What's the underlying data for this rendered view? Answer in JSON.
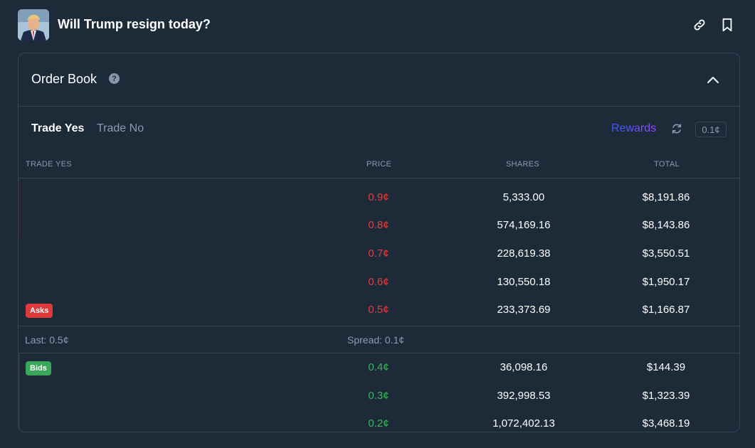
{
  "header": {
    "title": "Will Trump resign today?",
    "link_icon": "link-icon",
    "bookmark_icon": "bookmark-icon"
  },
  "order_book": {
    "title": "Order Book",
    "help_icon": "question-circle-icon",
    "help_glyph": "?",
    "collapse_icon": "chevron-up-icon"
  },
  "tabs": [
    {
      "label": "Trade Yes",
      "active": true
    },
    {
      "label": "Trade No",
      "active": false
    }
  ],
  "toolbar": {
    "rewards_label": "Rewards",
    "refresh_icon": "refresh-icon",
    "tick_size": "0.1¢"
  },
  "columns": {
    "side": "TRADE YES",
    "price": "PRICE",
    "shares": "SHARES",
    "total": "TOTAL"
  },
  "asks": [
    {
      "price": "0.9¢",
      "shares": "5,333.00",
      "total": "$8,191.86"
    },
    {
      "price": "0.8¢",
      "shares": "574,169.16",
      "total": "$8,143.86"
    },
    {
      "price": "0.7¢",
      "shares": "228,619.38",
      "total": "$3,550.51"
    },
    {
      "price": "0.6¢",
      "shares": "130,550.18",
      "total": "$1,950.17"
    },
    {
      "price": "0.5¢",
      "shares": "233,373.69",
      "total": "$1,166.87"
    }
  ],
  "asks_badge": "Asks",
  "spread_row": {
    "last": "Last: 0.5¢",
    "spread": "Spread: 0.1¢"
  },
  "bids_badge": "Bids",
  "bids": [
    {
      "price": "0.4¢",
      "shares": "36,098.16",
      "total": "$144.39"
    },
    {
      "price": "0.3¢",
      "shares": "392,998.53",
      "total": "$1,323.39"
    },
    {
      "price": "0.2¢",
      "shares": "1,072,402.13",
      "total": "$3,468.19"
    }
  ],
  "colors": {
    "background": "#1d2b39",
    "border": "#344452",
    "ask": "#e03f3f",
    "bid": "#3eb35f",
    "muted_text": "#8c9aab",
    "rewards_gradient_start": "#2e5bff",
    "rewards_gradient_end": "#9a4dff"
  }
}
